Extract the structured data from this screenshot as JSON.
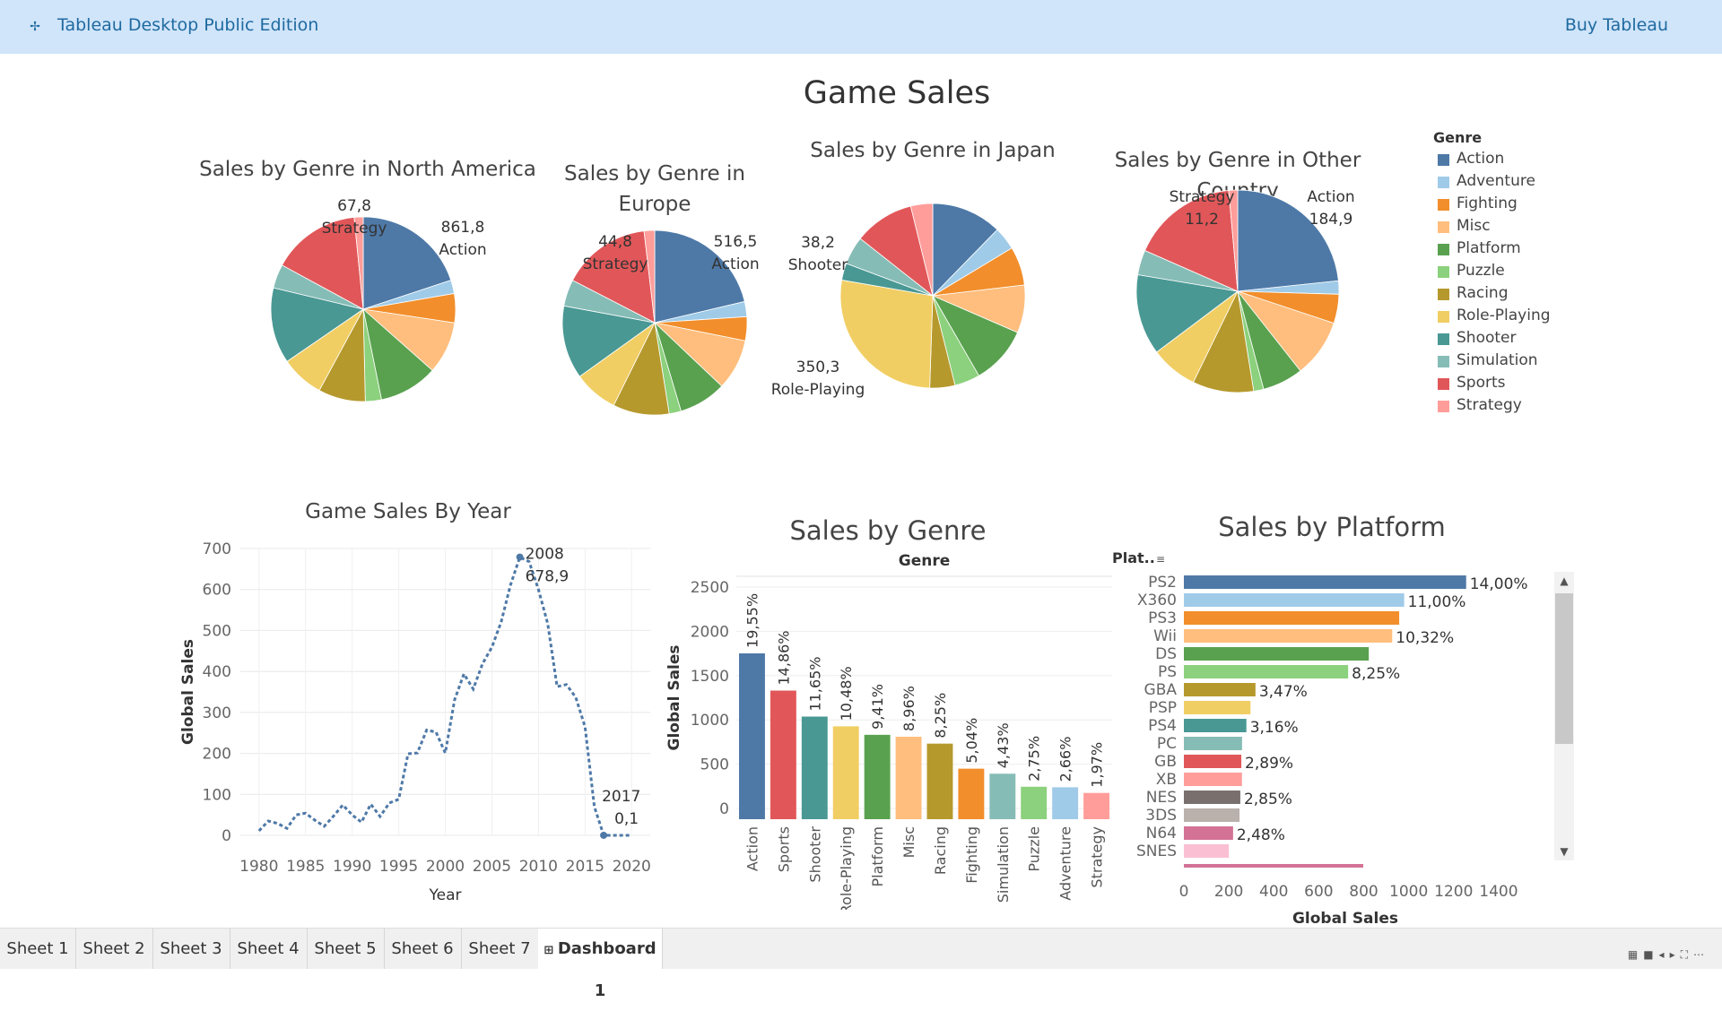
{
  "app": {
    "title": "Tableau Desktop Public Edition",
    "buy_label": "Buy Tableau",
    "logo_icon": "tableau-logo-icon"
  },
  "dashboard": {
    "title": "Game Sales"
  },
  "colors": {
    "Action": "#4e79a7",
    "Adventure": "#a0cbe8",
    "Fighting": "#f28e2b",
    "Misc": "#ffbe7d",
    "Platform": "#59a14f",
    "Puzzle": "#8cd17d",
    "Racing": "#b6992d",
    "Role-Playing": "#f1ce63",
    "Shooter": "#499894",
    "Simulation": "#86bcb6",
    "Sports": "#e15759",
    "Strategy": "#ff9d9a"
  },
  "legend": {
    "title": "Genre",
    "items": [
      "Action",
      "Adventure",
      "Fighting",
      "Misc",
      "Platform",
      "Puzzle",
      "Racing",
      "Role-Playing",
      "Shooter",
      "Simulation",
      "Sports",
      "Strategy"
    ]
  },
  "pie_titles": {
    "na": "Sales by Genre in North America",
    "eu_line1": "Sales by Genre in",
    "eu_line2": "Europe",
    "jp": "Sales by Genre in Japan",
    "other": "Sales by Genre in Other  Country"
  },
  "pie_labels": {
    "na_strategy_value": "67,8",
    "na_strategy_name": "Strategy",
    "na_action_value": "861,8",
    "na_action_name": "Action",
    "eu_strategy_value": "44,8",
    "eu_strategy_name": "Strategy",
    "eu_action_value": "516,5",
    "eu_action_name": "Action",
    "jp_shooter_value": "38,2",
    "jp_shooter_name": "Shooter",
    "jp_rpg_value": "350,3",
    "jp_rpg_name": "Role-Playing",
    "other_strategy_name": "Strategy",
    "other_strategy_value": "11,2",
    "other_action_name": "Action",
    "other_action_value": "184,9"
  },
  "line_chart": {
    "title": "Game Sales By Year",
    "xlabel": "Year",
    "ylabel": "Global Sales",
    "peak_year": "2008",
    "peak_value": "678,9",
    "end_year": "2017",
    "end_value": "0,1"
  },
  "genre_bar": {
    "title": "Sales by Genre",
    "header": "Genre",
    "ylabel": "Global Sales"
  },
  "platform_bar": {
    "title": "Sales by Platform",
    "header": "Plat..",
    "xlabel": "Global Sales",
    "sort_icon": "sort-icon"
  },
  "tabs": [
    "Sheet 1",
    "Sheet 2",
    "Sheet 3",
    "Sheet 4",
    "Sheet 5",
    "Sheet 6",
    "Sheet 7",
    "Dashboard 1"
  ],
  "chart_data": [
    {
      "type": "pie",
      "title": "Sales by Genre in North America",
      "categories": [
        "Action",
        "Adventure",
        "Fighting",
        "Misc",
        "Platform",
        "Puzzle",
        "Racing",
        "Role-Playing",
        "Shooter",
        "Simulation",
        "Sports",
        "Strategy"
      ],
      "values": [
        861.8,
        102.2,
        220.4,
        396.9,
        445.4,
        122.0,
        356.9,
        326.5,
        575.2,
        181.8,
        671.4,
        67.8
      ]
    },
    {
      "type": "pie",
      "title": "Sales by Genre in Europe",
      "categories": [
        "Action",
        "Adventure",
        "Fighting",
        "Misc",
        "Platform",
        "Puzzle",
        "Racing",
        "Role-Playing",
        "Shooter",
        "Simulation",
        "Sports",
        "Strategy"
      ],
      "values": [
        516.5,
        64.1,
        101.3,
        215.9,
        201.6,
        50.8,
        238.4,
        188.1,
        310.2,
        113.4,
        376.9,
        44.8
      ]
    },
    {
      "type": "pie",
      "title": "Sales by Genre in Japan",
      "categories": [
        "Action",
        "Adventure",
        "Fighting",
        "Misc",
        "Platform",
        "Puzzle",
        "Racing",
        "Role-Playing",
        "Shooter",
        "Simulation",
        "Sports",
        "Strategy"
      ],
      "values": [
        158.6,
        52.1,
        87.3,
        107.8,
        130.8,
        57.3,
        56.7,
        350.3,
        38.2,
        63.7,
        135.4,
        49.5
      ]
    },
    {
      "type": "pie",
      "title": "Sales by Genre in Other  Country",
      "categories": [
        "Action",
        "Adventure",
        "Fighting",
        "Misc",
        "Platform",
        "Puzzle",
        "Racing",
        "Role-Playing",
        "Shooter",
        "Simulation",
        "Sports",
        "Strategy"
      ],
      "values": [
        184.9,
        16.8,
        36.7,
        73.6,
        51.4,
        12.6,
        77.3,
        59.6,
        101.9,
        31.5,
        134.6,
        11.2
      ]
    },
    {
      "type": "line",
      "title": "Game Sales By Year",
      "xlabel": "Year",
      "ylabel": "Global Sales",
      "x": [
        1980,
        1981,
        1982,
        1983,
        1984,
        1985,
        1986,
        1987,
        1988,
        1989,
        1990,
        1991,
        1992,
        1993,
        1994,
        1995,
        1996,
        1997,
        1998,
        1999,
        2000,
        2001,
        2002,
        2003,
        2004,
        2005,
        2006,
        2007,
        2008,
        2009,
        2010,
        2011,
        2012,
        2013,
        2014,
        2015,
        2016,
        2017,
        2020
      ],
      "y": [
        11,
        35,
        29,
        17,
        50,
        54,
        37,
        22,
        47,
        74,
        50,
        32,
        76,
        46,
        79,
        88,
        199,
        201,
        257,
        252,
        201,
        331,
        394,
        357,
        419,
        459,
        521,
        611,
        679,
        668,
        600,
        516,
        363,
        368,
        337,
        265,
        70,
        0.1,
        0.1
      ],
      "xlim": [
        1978,
        2022
      ],
      "ylim": [
        0,
        700
      ],
      "xticks": [
        1980,
        1985,
        1990,
        1995,
        2000,
        2005,
        2010,
        2015,
        2020
      ],
      "yticks": [
        0,
        100,
        200,
        300,
        400,
        500,
        600,
        700
      ],
      "grid": true,
      "style": "dashed"
    },
    {
      "type": "bar",
      "title": "Sales by Genre",
      "ylabel": "Global Sales",
      "categories": [
        "Action",
        "Sports",
        "Shooter",
        "Role-Playing",
        "Platform",
        "Misc",
        "Racing",
        "Fighting",
        "Simulation",
        "Puzzle",
        "Adventure",
        "Strategy"
      ],
      "values": [
        1751.2,
        1330.9,
        1037.4,
        927.4,
        831.4,
        809.9,
        732.0,
        448.9,
        392.2,
        244.9,
        239.0,
        175.1
      ],
      "labels": [
        "19,55%",
        "14,86%",
        "11,65%",
        "10,48%",
        "9,41%",
        "8,96%",
        "8,25%",
        "5,04%",
        "4,43%",
        "2,75%",
        "2,66%",
        "1,97%"
      ],
      "ylim": [
        0,
        2500
      ],
      "yticks": [
        0,
        500,
        1000,
        1500,
        2000,
        2500
      ]
    },
    {
      "type": "bar",
      "orientation": "horizontal",
      "title": "Sales by Platform",
      "xlabel": "Global Sales",
      "categories": [
        "PS2",
        "X360",
        "PS3",
        "Wii",
        "DS",
        "PS",
        "GBA",
        "PSP",
        "PS4",
        "PC",
        "GB",
        "XB",
        "NES",
        "3DS",
        "N64",
        "SNES"
      ],
      "values": [
        1255.6,
        979.9,
        957.8,
        926.7,
        822.5,
        730.7,
        318.5,
        296.3,
        278.1,
        258.8,
        255.5,
        258.3,
        251.1,
        247.5,
        218.9,
        200.1
      ],
      "labels": [
        "14,00%",
        "11,00%",
        "",
        "10,32%",
        "",
        "8,25%",
        "3,47%",
        "",
        "3,16%",
        "",
        "2,89%",
        "",
        "2,85%",
        "",
        "2,48%",
        ""
      ],
      "colors": [
        "#4e79a7",
        "#a0cbe8",
        "#f28e2b",
        "#ffbe7d",
        "#59a14f",
        "#8cd17d",
        "#b6992d",
        "#f1ce63",
        "#499894",
        "#86bcb6",
        "#e15759",
        "#ff9d9a",
        "#79706e",
        "#bab0ac",
        "#d37295",
        "#fabfd2"
      ],
      "xlim": [
        0,
        1500
      ],
      "xticks": [
        0,
        200,
        400,
        600,
        800,
        1000,
        1200,
        1400
      ]
    }
  ]
}
